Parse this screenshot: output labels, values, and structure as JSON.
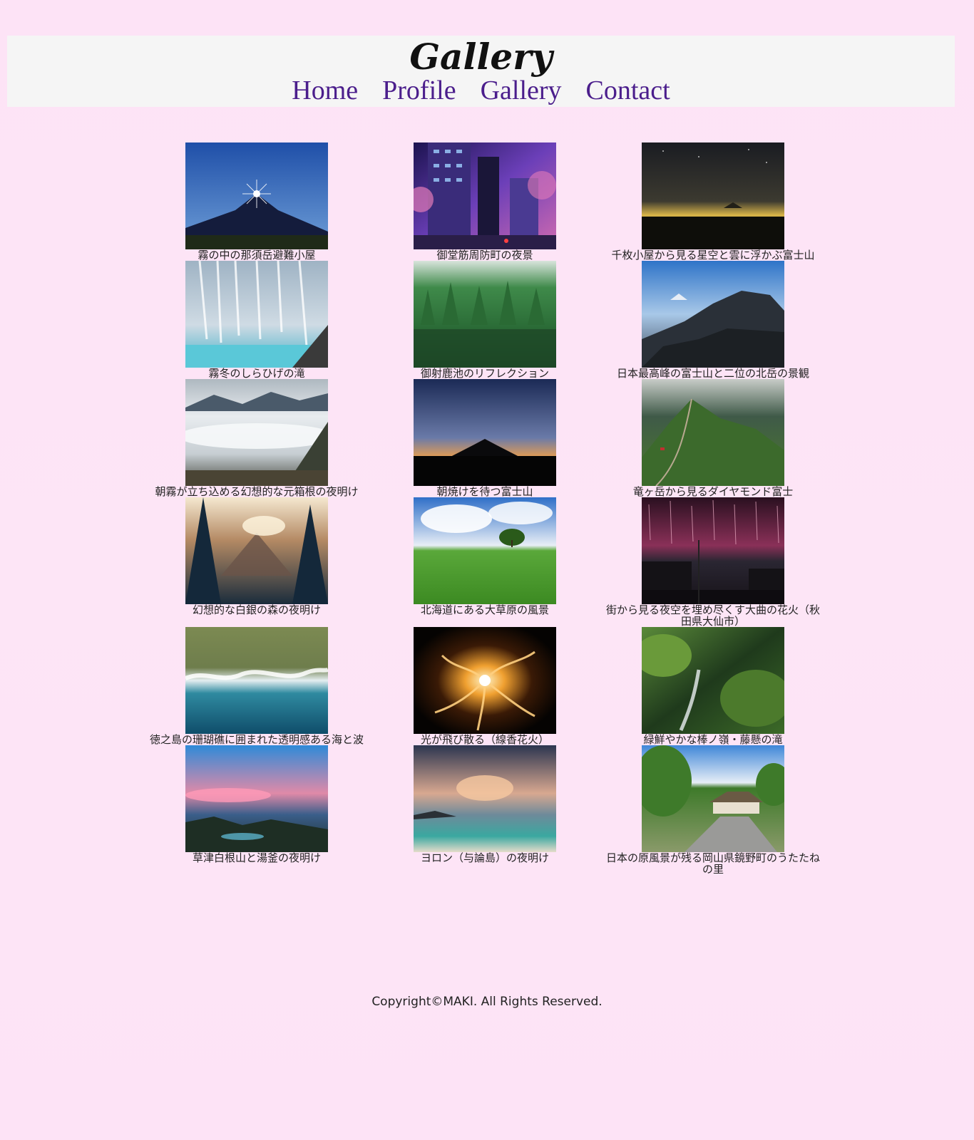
{
  "header": {
    "title": "Gallery",
    "nav": [
      "Home",
      "Profile",
      "Gallery",
      "Contact"
    ]
  },
  "gallery": {
    "rows": [
      [
        {
          "caption": "霧の中の那須岳避難小屋",
          "icon": "photo-fuji-diamond"
        },
        {
          "caption": "御堂筋周防町の夜景",
          "icon": "photo-city-night"
        },
        {
          "caption": "千枚小屋から見る星空と雲に浮かぶ富士山",
          "icon": "photo-night-sky-fuji"
        }
      ],
      [
        {
          "caption": "霧冬のしらひげの滝",
          "icon": "photo-waterfall-ice"
        },
        {
          "caption": "御射鹿池のリフレクション",
          "icon": "photo-forest-pond"
        },
        {
          "caption": "日本最高峰の富士山と二位の北岳の景観",
          "icon": "photo-mountain-ridge"
        }
      ],
      [
        {
          "caption": "朝霧が立ち込める幻想的な元箱根の夜明け",
          "icon": "photo-sea-of-clouds"
        },
        {
          "caption": "朝焼けを待つ富士山",
          "icon": "photo-fuji-silhouette"
        },
        {
          "caption": "竜ヶ岳から見るダイヤモンド富士",
          "icon": "photo-green-ridge"
        }
      ],
      [
        {
          "caption": "幻想的な白銀の森の夜明け",
          "icon": "photo-snow-forest"
        },
        {
          "caption": "北海道にある大草原の風景",
          "icon": "photo-grassland"
        },
        {
          "caption": "街から見る夜空を埋め尽くす大曲の花火（秋田県大仙市）",
          "icon": "photo-fireworks"
        }
      ],
      [
        {
          "caption": "徳之島の珊瑚礁に囲まれた透明感ある海と波",
          "icon": "photo-aerial-coast"
        },
        {
          "caption": "光が飛び散る（線香花火）",
          "icon": "photo-sparkler"
        },
        {
          "caption": "緑鮮やかな棒ノ嶺・藤懸の滝",
          "icon": "photo-mossy-falls"
        }
      ],
      [
        {
          "caption": "草津白根山と湯釜の夜明け",
          "icon": "photo-dawn-sky"
        },
        {
          "caption": "ヨロン（与論島）の夜明け",
          "icon": "photo-beach-dawn"
        },
        {
          "caption": "日本の原風景が残る岡山県鏡野町のうたたねの里",
          "icon": "photo-thatched-house"
        }
      ]
    ]
  },
  "footer": {
    "copyright": "Copyright©MAKI. All Rights Reserved."
  }
}
